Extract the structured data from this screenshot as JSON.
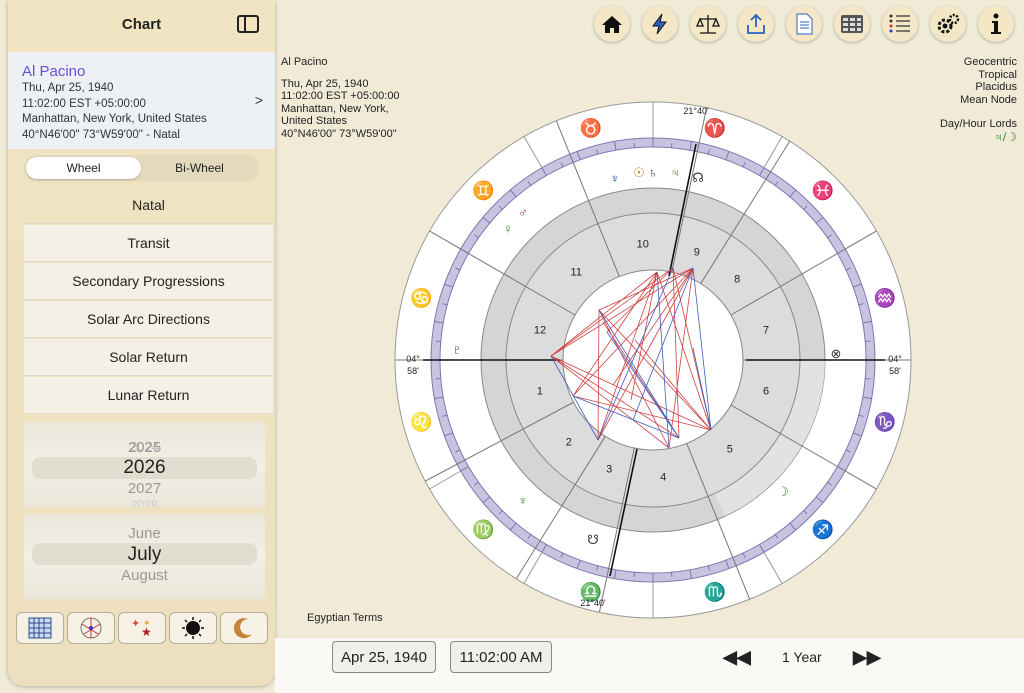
{
  "sidebar": {
    "title": "Chart",
    "person": {
      "name": "Al Pacino",
      "date": "Thu, Apr 25, 1940",
      "time": "11:02:00 EST +05:00:00",
      "place": "Manhattan, New York, United States",
      "coords": "40°N46'00\" 73°W59'00\" - Natal"
    },
    "segments": [
      "Wheel",
      "Bi-Wheel"
    ],
    "menu": [
      "Natal",
      "Transit",
      "Secondary Progressions",
      "Solar Arc Directions",
      "Solar Return",
      "Lunar Return"
    ],
    "year_picker": {
      "above2": "2024",
      "above": "2025",
      "selected": "2026",
      "below": "2027",
      "below2": "2028"
    },
    "month_picker": {
      "above": "June",
      "selected": "July",
      "below": "August"
    }
  },
  "chart_info": {
    "name": "Al Pacino",
    "date": "Thu, Apr 25, 1940",
    "time": "11:02:00 EST +05:00:00",
    "place1": "Manhattan, New York,",
    "place2": "United States",
    "coords": "40°N46'00\" 73°W59'00\""
  },
  "chart_settings": {
    "zodiac1": "Geocentric",
    "zodiac2": "Tropical",
    "house": "Placidus",
    "node": "Mean Node",
    "lords_label": "Day/Hour Lords",
    "lords_value": "♃/☽"
  },
  "terms_label": "Egyptian Terms",
  "bottom": {
    "date": "Apr 25, 1940",
    "time": "11:02:00 AM",
    "step": "1 Year"
  },
  "wheel": {
    "house_numbers": [
      "1",
      "2",
      "3",
      "4",
      "5",
      "6",
      "7",
      "8",
      "9",
      "10",
      "11",
      "12"
    ],
    "cusp_degrees": {
      "asc": "04°",
      "asc_min": "58'",
      "dsc": "04°",
      "dsc_min": "58'",
      "mc": "21°40'",
      "ic": "21°40'"
    }
  }
}
